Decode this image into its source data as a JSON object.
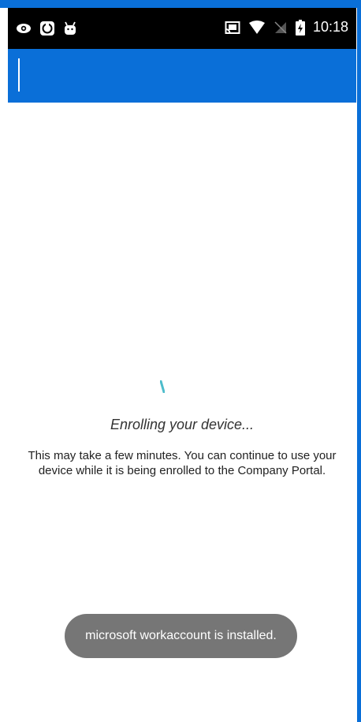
{
  "colors": {
    "accent": "#0a6fd8",
    "status_bar": "#000000",
    "spinner": "#4dbccb",
    "toast_bg": "#767676"
  },
  "status_bar": {
    "left_icons": [
      "eye-icon",
      "circle-app-icon",
      "android-robot-icon"
    ],
    "right_icons": [
      "cast-icon",
      "wifi-icon",
      "no-signal-icon",
      "battery-charging-icon"
    ],
    "time": "10:18"
  },
  "main": {
    "title": "Enrolling your device...",
    "description": "This may take a few minutes. You can continue to use your device while it is being enrolled to the Company Portal."
  },
  "toast": {
    "message": "microsoft workaccount is installed."
  }
}
